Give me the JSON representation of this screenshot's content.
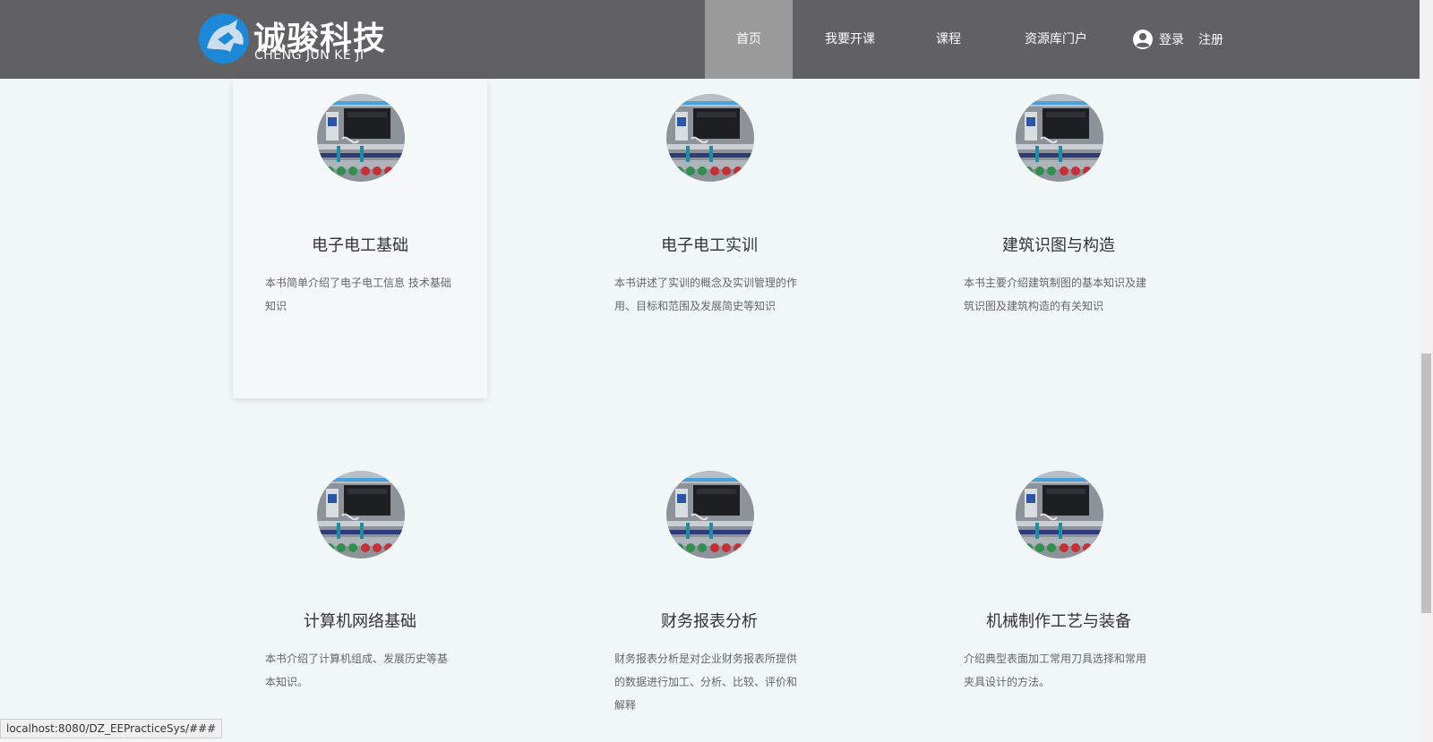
{
  "header": {
    "logo_title": "诚骏科技",
    "logo_subtitle": "CHENG JUN KE JI",
    "nav": [
      {
        "label": "首页",
        "active": true
      },
      {
        "label": "我要开课",
        "active": false
      },
      {
        "label": "课程",
        "active": false
      },
      {
        "label": "资源库门户",
        "active": false
      }
    ],
    "login_label": "登录",
    "register_label": "注册"
  },
  "courses": [
    {
      "title": "电子电工基础",
      "description": "本书简单介绍了电子电工信息 技术基础知识"
    },
    {
      "title": "电子电工实训",
      "description": "本书讲述了实训的概念及实训管理的作用、目标和范围及发展简史等知识"
    },
    {
      "title": "建筑识图与构造",
      "description": "本书主要介绍建筑制图的基本知识及建筑识图及建筑构造的有关知识"
    },
    {
      "title": "计算机网络基础",
      "description": "本书介绍了计算机组成、发展历史等基本知识。"
    },
    {
      "title": "财务报表分析",
      "description": "财务报表分析是对企业财务报表所提供的数据进行加工、分析、比较、评价和解释"
    },
    {
      "title": "机械制作工艺与装备",
      "description": "介绍典型表面加工常用刀具选择和常用夹具设计的方法。"
    }
  ],
  "status_bar": {
    "url": "localhost:8080/DZ_EEPracticeSys/###"
  },
  "colors": {
    "header_bg": "#616163",
    "nav_active_bg": "#9a9a9a",
    "page_bg": "#f1f6f6",
    "logo_blue": "#1e88d8"
  }
}
